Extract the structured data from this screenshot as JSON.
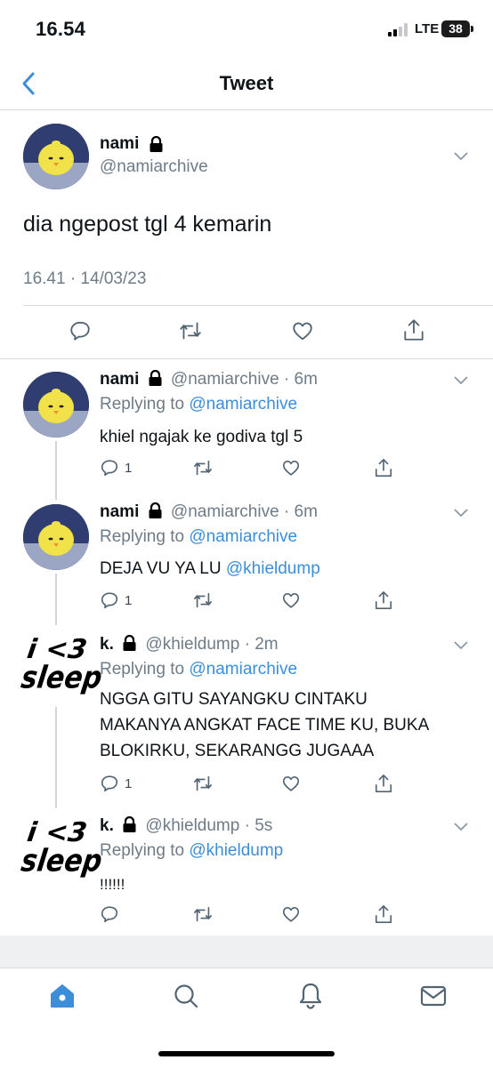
{
  "status_bar": {
    "time": "16.54",
    "network": "LTE",
    "battery": "38"
  },
  "nav": {
    "title": "Tweet"
  },
  "main_tweet": {
    "name": "nami",
    "handle": "@namiarchive",
    "text": "dia ngepost tgl 4 kemarin",
    "timestamp": "16.41 · 14/03/23"
  },
  "replies": [
    {
      "name": "nami",
      "handle": "@namiarchive",
      "age": "· 6m",
      "replying_label": "Replying to",
      "replying_to": "@namiarchive",
      "text": "khiel ngajak ke godiva tgl 5",
      "mention": "",
      "reply_count": "1"
    },
    {
      "name": "nami",
      "handle": "@namiarchive",
      "age": "· 6m",
      "replying_label": "Replying to",
      "replying_to": "@namiarchive",
      "text": "DEJA VU YA LU ",
      "mention": "@khieldump",
      "reply_count": "1"
    },
    {
      "name": "k.",
      "handle": "@khieldump",
      "age": "· 2m",
      "replying_label": "Replying to",
      "replying_to": "@namiarchive",
      "text_lines": [
        "NGGA GITU SAYANGKU CINTAKU",
        "MAKANYA ANGKAT FACE TIME KU, BUKA",
        "BLOKIRKU, SEKARANGG JUGAAA"
      ],
      "reply_count": "1"
    },
    {
      "name": "k.",
      "handle": "@khieldump",
      "age": "· 5s",
      "replying_label": "Replying to",
      "replying_to": "@khieldump",
      "text": "!!!!!!",
      "reply_count": ""
    }
  ],
  "avatar_text": {
    "line1": "i <3",
    "line2": "sleep"
  },
  "colors": {
    "accent": "#3d8ed8",
    "secondary_text": "#6e7c87",
    "divider": "#d8dde1"
  },
  "tab_bar": {
    "items": [
      "home-icon",
      "search-icon",
      "notifications-icon",
      "messages-icon"
    ],
    "active": "home-icon"
  }
}
